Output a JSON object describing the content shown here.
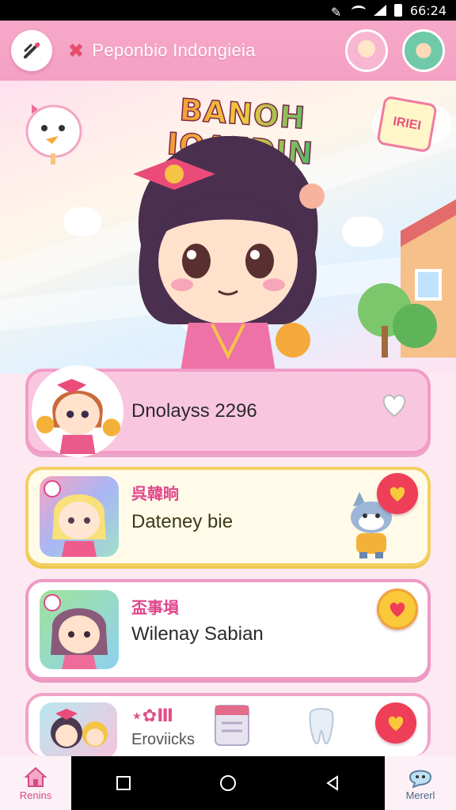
{
  "status_bar": {
    "time": "66:24"
  },
  "app_bar": {
    "title": "Peponbio Indongieia"
  },
  "hero": {
    "banner_title": "BANOH IOAEDIN",
    "sign_text": "IRIЕI"
  },
  "cards": [
    {
      "title": "Dnolayss 2296",
      "subtitle": ""
    },
    {
      "subtitle": "呉韓晌",
      "title": "Dateney bie"
    },
    {
      "subtitle": "盃事塤",
      "title": "Wilenay Sabian"
    },
    {
      "badge": "⋆✿Ⅲ",
      "title": "Eroviicks"
    }
  ],
  "nav": {
    "left_label": "Renins",
    "right_label": "Mererl"
  },
  "colors": {
    "pink": "#f7a8c8",
    "accent_red": "#ef3e57",
    "accent_yellow": "#f9c93a"
  }
}
